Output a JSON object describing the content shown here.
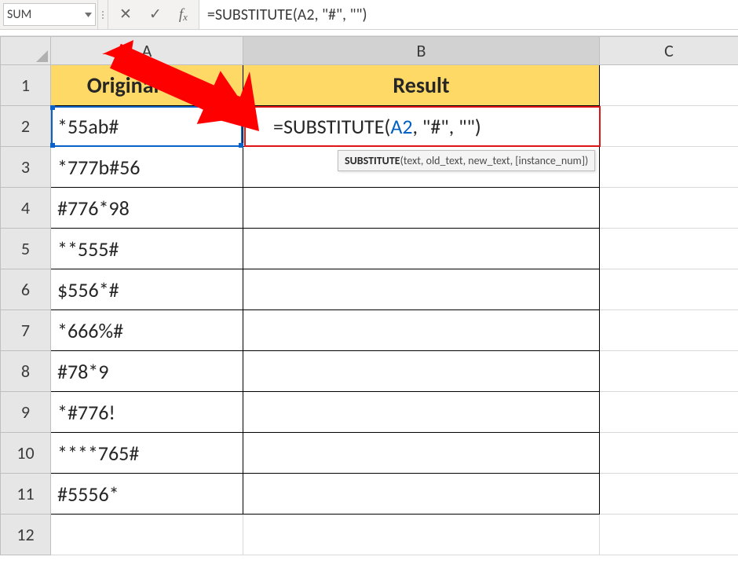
{
  "nameBox": {
    "value": "SUM"
  },
  "formulaBar": {
    "formula": "=SUBSTITUTE(A2, \"#\", \"\")"
  },
  "columns": [
    "A",
    "B",
    "C"
  ],
  "headerRow": {
    "A": "Original Data",
    "B": "Result"
  },
  "editingCell": {
    "prefix": "=SUBSTITUTE(",
    "ref": "A2",
    "suffix": ", \"#\", \"\")"
  },
  "tooltip": {
    "bold": "SUBSTITUTE",
    "rest": "(text, old_text, new_text, [instance_num])"
  },
  "rows": [
    {
      "num": 1
    },
    {
      "num": 2,
      "A": "*55ab#"
    },
    {
      "num": 3,
      "A": "*777b#56"
    },
    {
      "num": 4,
      "A": "#776*98"
    },
    {
      "num": 5,
      "A": "**555#"
    },
    {
      "num": 6,
      "A": "$556*#"
    },
    {
      "num": 7,
      "A": "*666%#"
    },
    {
      "num": 8,
      "A": "#78*9"
    },
    {
      "num": 9,
      "A": "*#776!"
    },
    {
      "num": 10,
      "A": "****765#"
    },
    {
      "num": 11,
      "A": "#5556*"
    },
    {
      "num": 12
    }
  ]
}
